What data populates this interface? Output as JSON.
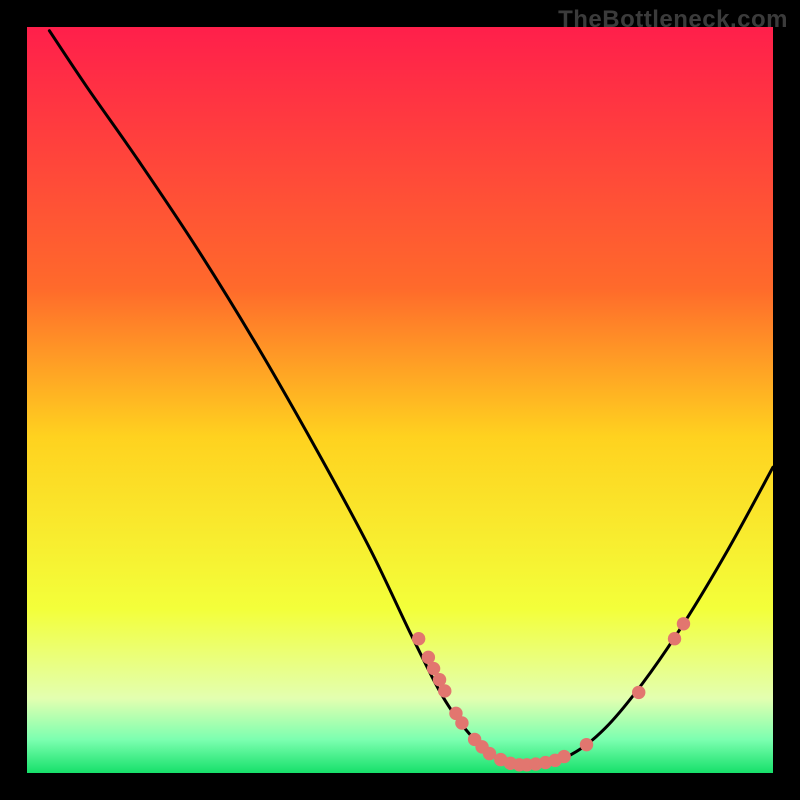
{
  "watermark": "TheBottleneck.com",
  "chart_data": {
    "type": "line",
    "title": "",
    "xlabel": "",
    "ylabel": "",
    "xlim": [
      0,
      100
    ],
    "ylim": [
      0,
      100
    ],
    "gradient_stops": [
      {
        "offset": 0,
        "color": "#ff1f4b"
      },
      {
        "offset": 0.35,
        "color": "#ff6a2b"
      },
      {
        "offset": 0.55,
        "color": "#ffd21f"
      },
      {
        "offset": 0.78,
        "color": "#f3ff3a"
      },
      {
        "offset": 0.9,
        "color": "#e3ffb0"
      },
      {
        "offset": 0.955,
        "color": "#7cffb0"
      },
      {
        "offset": 1.0,
        "color": "#16e06a"
      }
    ],
    "curve": {
      "comment": "V/check-shaped bottleneck curve; y is percent (100=top). Minimum around x≈67.",
      "points": [
        {
          "x": 3.0,
          "y": 99.5
        },
        {
          "x": 8.0,
          "y": 92.0
        },
        {
          "x": 15.0,
          "y": 82.0
        },
        {
          "x": 23.0,
          "y": 70.0
        },
        {
          "x": 31.0,
          "y": 57.0
        },
        {
          "x": 39.0,
          "y": 43.0
        },
        {
          "x": 46.0,
          "y": 30.0
        },
        {
          "x": 52.0,
          "y": 17.5
        },
        {
          "x": 56.5,
          "y": 9.0
        },
        {
          "x": 61.0,
          "y": 3.5
        },
        {
          "x": 65.0,
          "y": 1.2
        },
        {
          "x": 69.0,
          "y": 1.2
        },
        {
          "x": 73.0,
          "y": 2.5
        },
        {
          "x": 77.5,
          "y": 6.0
        },
        {
          "x": 82.5,
          "y": 12.0
        },
        {
          "x": 88.0,
          "y": 20.0
        },
        {
          "x": 94.0,
          "y": 30.0
        },
        {
          "x": 100.0,
          "y": 41.0
        }
      ]
    },
    "dots": {
      "color": "#e2766f",
      "radius_pct": 0.9,
      "points": [
        {
          "x": 52.5,
          "y": 18.0
        },
        {
          "x": 53.8,
          "y": 15.5
        },
        {
          "x": 54.5,
          "y": 14.0
        },
        {
          "x": 55.3,
          "y": 12.5
        },
        {
          "x": 56.0,
          "y": 11.0
        },
        {
          "x": 57.5,
          "y": 8.0
        },
        {
          "x": 58.3,
          "y": 6.7
        },
        {
          "x": 60.0,
          "y": 4.5
        },
        {
          "x": 61.0,
          "y": 3.5
        },
        {
          "x": 62.0,
          "y": 2.6
        },
        {
          "x": 63.5,
          "y": 1.8
        },
        {
          "x": 64.8,
          "y": 1.3
        },
        {
          "x": 66.0,
          "y": 1.1
        },
        {
          "x": 67.0,
          "y": 1.1
        },
        {
          "x": 68.2,
          "y": 1.2
        },
        {
          "x": 69.5,
          "y": 1.4
        },
        {
          "x": 70.8,
          "y": 1.7
        },
        {
          "x": 72.0,
          "y": 2.2
        },
        {
          "x": 75.0,
          "y": 3.8
        },
        {
          "x": 82.0,
          "y": 10.8
        },
        {
          "x": 86.8,
          "y": 18.0
        },
        {
          "x": 88.0,
          "y": 20.0
        }
      ]
    }
  }
}
